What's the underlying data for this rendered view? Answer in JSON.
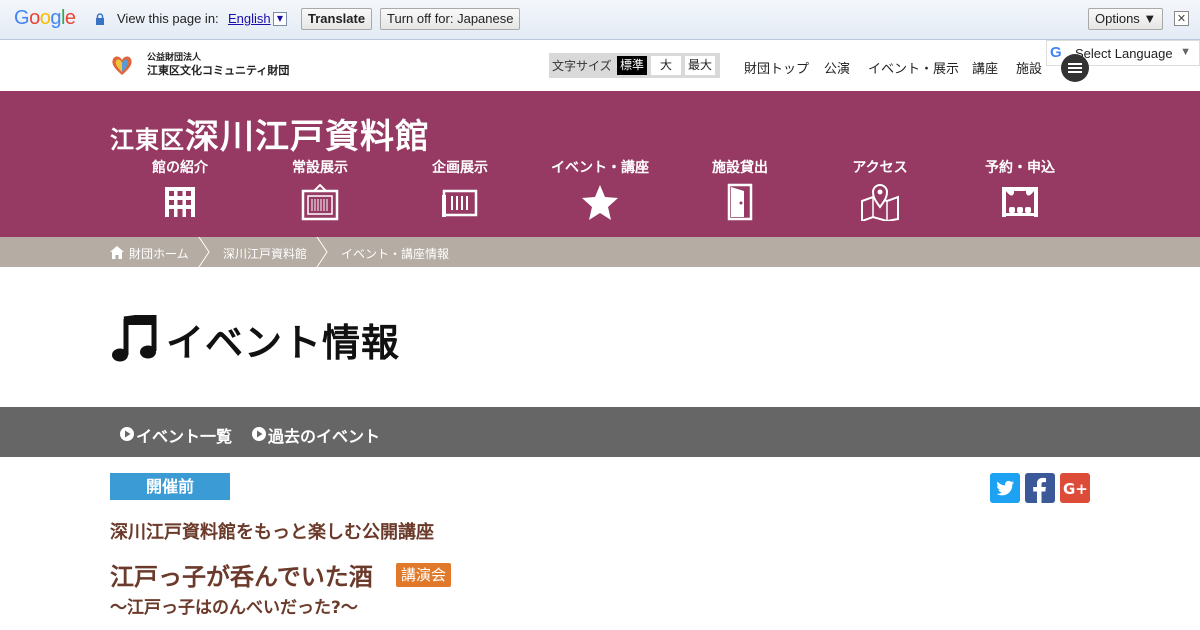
{
  "translate_bar": {
    "logo": "Google",
    "view_text": "View this page in:",
    "language": "English",
    "caret": "▼",
    "translate_button": "Translate",
    "turnoff_button": "Turn off for: Japanese",
    "options_button": "Options ▼",
    "close": "✕"
  },
  "header": {
    "org_line1": "公益財団法人",
    "org_line2": "江東区文化コミュニティ財団",
    "fontsize_label": "文字サイズ",
    "fontsize_options": [
      "標準",
      "大",
      "最大"
    ],
    "fontsize_selected": "標準",
    "top_nav": [
      "財団トップ",
      "公演",
      "イベント・展示",
      "講座",
      "施設"
    ],
    "language_select": "Select Language",
    "language_select_caret": "▼"
  },
  "banner": {
    "title_prefix": "江東区",
    "title_main": "深川江戸資料館",
    "main_nav": [
      {
        "label": "館の紹介",
        "icon": "building-icon"
      },
      {
        "label": "常設展示",
        "icon": "exhibit-frame-icon"
      },
      {
        "label": "企画展示",
        "icon": "special-exhibit-icon"
      },
      {
        "label": "イベント・講座",
        "icon": "star-icon"
      },
      {
        "label": "施設貸出",
        "icon": "door-icon"
      },
      {
        "label": "アクセス",
        "icon": "map-pin-icon"
      },
      {
        "label": "予約・申込",
        "icon": "theater-icon"
      }
    ],
    "background_color": "#963a64"
  },
  "breadcrumb": [
    "財団ホーム",
    "深川江戸資料館",
    "イベント・講座情報"
  ],
  "page": {
    "title": "イベント情報"
  },
  "subnav": [
    "イベント一覧",
    "過去のイベント"
  ],
  "event": {
    "status": "開催前",
    "series": "深川江戸資料館をもっと楽しむ公開講座",
    "title": "江戸っ子が呑んでいた酒",
    "tag": "講演会",
    "subtitle": "～江戸っ子はのんべいだった?～"
  },
  "share": {
    "twitter": "twitter-icon",
    "facebook": "facebook-icon",
    "google_plus": "google-plus-icon"
  }
}
